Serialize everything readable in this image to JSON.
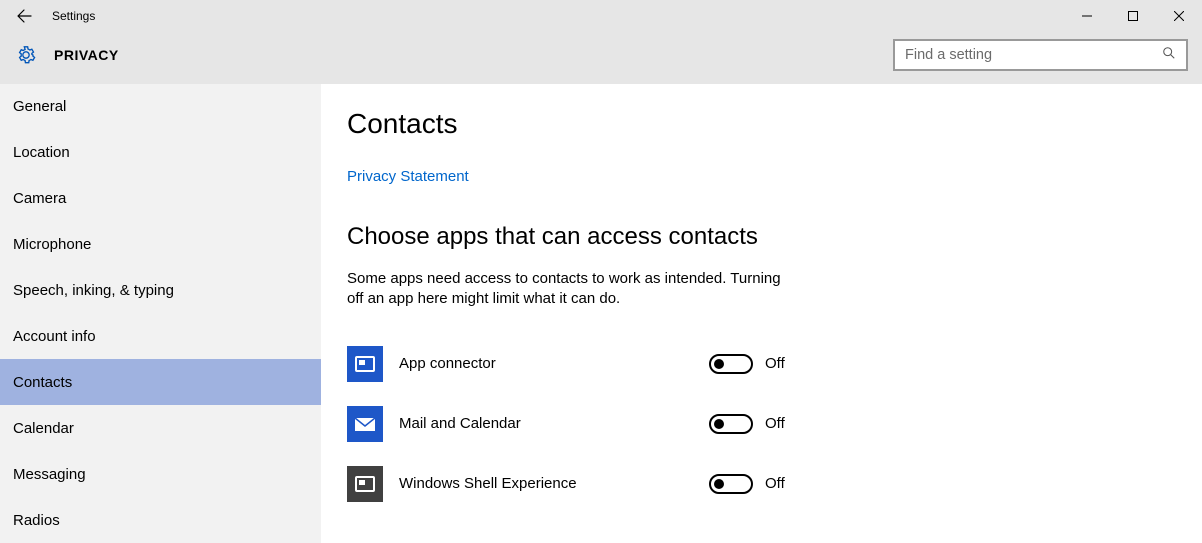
{
  "window": {
    "title": "Settings"
  },
  "header": {
    "category": "PRIVACY"
  },
  "search": {
    "placeholder": "Find a setting"
  },
  "sidebar": {
    "items": [
      {
        "label": "General",
        "selected": false
      },
      {
        "label": "Location",
        "selected": false
      },
      {
        "label": "Camera",
        "selected": false
      },
      {
        "label": "Microphone",
        "selected": false
      },
      {
        "label": "Speech, inking, & typing",
        "selected": false
      },
      {
        "label": "Account info",
        "selected": false
      },
      {
        "label": "Contacts",
        "selected": true
      },
      {
        "label": "Calendar",
        "selected": false
      },
      {
        "label": "Messaging",
        "selected": false
      },
      {
        "label": "Radios",
        "selected": false
      }
    ]
  },
  "page": {
    "title": "Contacts",
    "privacy_link": "Privacy Statement",
    "section_title": "Choose apps that can access contacts",
    "description": "Some apps need access to contacts to work as intended. Turning off an app here might limit what it can do.",
    "apps": [
      {
        "name": "App connector",
        "icon": "app-connector",
        "state": "Off"
      },
      {
        "name": "Mail and Calendar",
        "icon": "mail",
        "state": "Off"
      },
      {
        "name": "Windows Shell Experience",
        "icon": "shell",
        "state": "Off"
      }
    ]
  },
  "colors": {
    "selection": "#9fb2e0",
    "link": "#0066cc",
    "tile_blue": "#1e57c8",
    "tile_dark": "#404040"
  }
}
